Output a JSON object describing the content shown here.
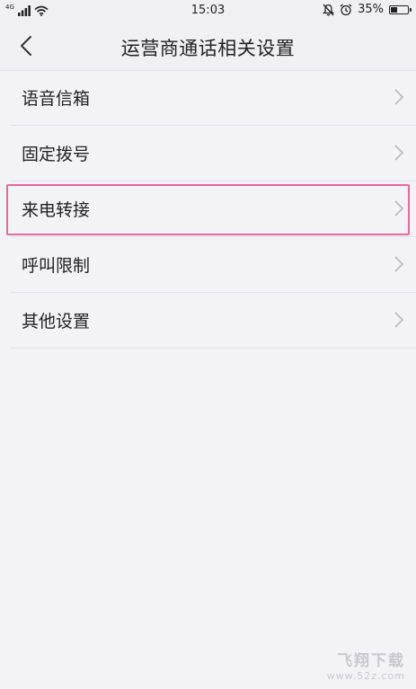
{
  "status_bar": {
    "network": "4G",
    "time": "15:03",
    "battery_percent": "35%",
    "icons": [
      "signal-icon",
      "wifi-icon",
      "bell-muted-icon",
      "alarm-icon",
      "battery-icon"
    ]
  },
  "header": {
    "title": "运营商通话相关设置",
    "back_icon": "chevron-left-icon"
  },
  "list": {
    "items": [
      {
        "label": "语音信箱"
      },
      {
        "label": "固定拨号"
      },
      {
        "label": "来电转接",
        "highlighted": true
      },
      {
        "label": "呼叫限制"
      },
      {
        "label": "其他设置"
      }
    ],
    "chevron_icon": "chevron-right-icon"
  },
  "highlight_color": "#e26a9c",
  "watermark": {
    "name": "飞翔下载",
    "url": "www.52z.com"
  }
}
